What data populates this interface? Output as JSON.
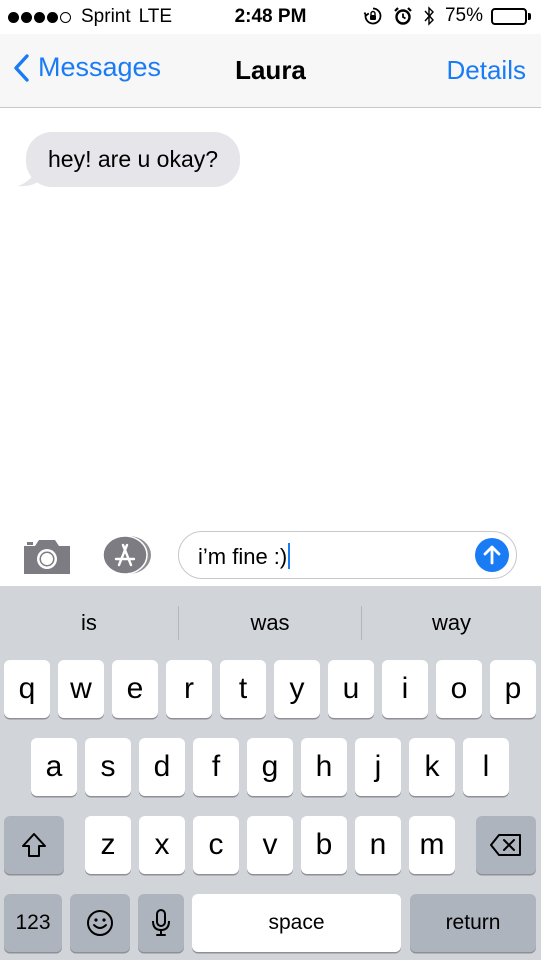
{
  "status_bar": {
    "carrier": "Sprint",
    "network": "LTE",
    "time": "2:48 PM",
    "battery": "75%",
    "battery_level": 0.75,
    "signal_bars": 4,
    "signal_total": 5,
    "icons": [
      "rotation-lock-icon",
      "alarm-icon",
      "bluetooth-icon",
      "battery-icon"
    ]
  },
  "nav": {
    "back_label": "Messages",
    "title": "Laura",
    "details_label": "Details"
  },
  "messages": [
    {
      "direction": "incoming",
      "text": "hey! are u okay?"
    }
  ],
  "input": {
    "value": "i’m fine :)",
    "icons": [
      "camera-icon",
      "app-store-icon",
      "send-arrow-icon"
    ]
  },
  "keyboard": {
    "suggestions": [
      "is",
      "was",
      "way"
    ],
    "row1": [
      "q",
      "w",
      "e",
      "r",
      "t",
      "y",
      "u",
      "i",
      "o",
      "p"
    ],
    "row2": [
      "a",
      "s",
      "d",
      "f",
      "g",
      "h",
      "j",
      "k",
      "l"
    ],
    "row3": [
      "z",
      "x",
      "c",
      "v",
      "b",
      "n",
      "m"
    ],
    "numbers_label": "123",
    "space_label": "space",
    "return_label": "return"
  },
  "colors": {
    "accent": "#1a7cf5",
    "bubble_incoming": "#e5e5ea",
    "keyboard_bg": "#d1d4d9",
    "key_dark": "#aeb4bd"
  }
}
